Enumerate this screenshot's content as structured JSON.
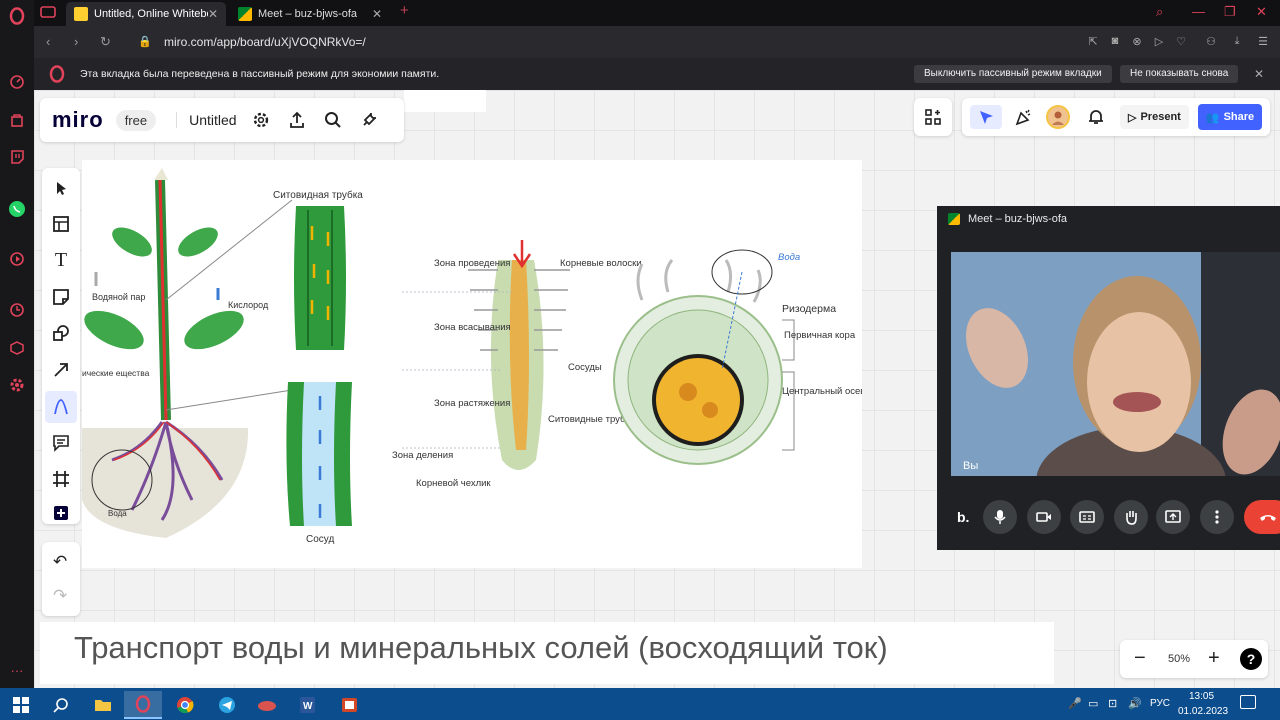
{
  "browser": {
    "tabs": [
      {
        "title": "Untitled, Online Whiteboard",
        "active": true
      },
      {
        "title": "Meet – buz-bjws-ofa",
        "active": false
      }
    ],
    "url": "miro.com/app/board/uXjVOQNRkVo=/",
    "notification": {
      "text": "Эта вкладка была переведена в пассивный режим для экономии памяти.",
      "disable_label": "Выключить пассивный режим вкладки",
      "dismiss_label": "Не показывать снова"
    }
  },
  "miro": {
    "logo": "miro",
    "plan": "free",
    "board_title": "Untitled",
    "present_label": "Present",
    "share_label": "Share",
    "zoom_level": "50%",
    "help_label": "?",
    "accent_color": "#4262ff"
  },
  "diagram": {
    "plant_labels": {
      "water_vapor": "Водяной пар",
      "oxygen": "Кислород",
      "organic": "ические ещества",
      "water": "Вода",
      "sieve_tube": "Ситовидная трубка",
      "vessel": "Сосуд"
    },
    "root_labels": {
      "conduction": "Зона проведения",
      "absorption": "Зона всасывания",
      "elongation": "Зона растяжения",
      "division": "Зона деления",
      "cap": "Корневой чехлик",
      "root_hairs": "Корневые волоски",
      "vessels": "Сосуды",
      "sieve_tubes": "Ситовидные трубки"
    },
    "section_labels": {
      "water": "Вода",
      "rhizoderm": "Ризодерма",
      "cortex": "Первичная кора",
      "central": "Центральный осевой цилиндр"
    }
  },
  "caption": "Транспорт воды и минеральных солей (восходящий ток)",
  "meet": {
    "title": "Meet – buz-bjws-ofa",
    "you_label": "Вы",
    "letter": "b."
  },
  "taskbar": {
    "lang": "РУС",
    "time": "13:05",
    "date": "01.02.2023"
  }
}
